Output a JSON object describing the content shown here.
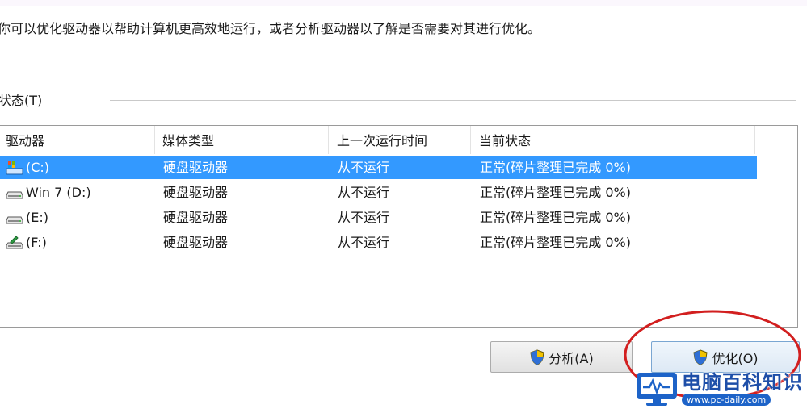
{
  "description": "你可以优化驱动器以帮助计算机更高效地运行，或者分析驱动器以了解是否需要对其进行优化。",
  "status_section": {
    "label": "状态(T)"
  },
  "table": {
    "columns": [
      "驱动器",
      "媒体类型",
      "上一次运行时间",
      "当前状态"
    ],
    "rows": [
      {
        "drive": "(C:)",
        "icon": "system-drive-icon",
        "media": "硬盘驱动器",
        "last_run": "从不运行",
        "status": "正常(碎片整理已完成 0%)",
        "selected": true
      },
      {
        "drive": "Win 7 (D:)",
        "icon": "hard-drive-icon",
        "media": "硬盘驱动器",
        "last_run": "从不运行",
        "status": "正常(碎片整理已完成 0%)",
        "selected": false
      },
      {
        "drive": "(E:)",
        "icon": "hard-drive-icon",
        "media": "硬盘驱动器",
        "last_run": "从不运行",
        "status": "正常(碎片整理已完成 0%)",
        "selected": false
      },
      {
        "drive": "(F:)",
        "icon": "shared-drive-icon",
        "media": "硬盘驱动器",
        "last_run": "从不运行",
        "status": "正常(碎片整理已完成 0%)",
        "selected": false
      }
    ]
  },
  "buttons": {
    "analyze": "分析(A)",
    "optimize": "优化(O)"
  },
  "watermark": {
    "title": "电脑百科知识",
    "site": "www.pc-daily.com"
  },
  "colors": {
    "selection": "#3399ff",
    "annotation": "#d21f1f",
    "watermark_blue": "#1d4ea8"
  }
}
